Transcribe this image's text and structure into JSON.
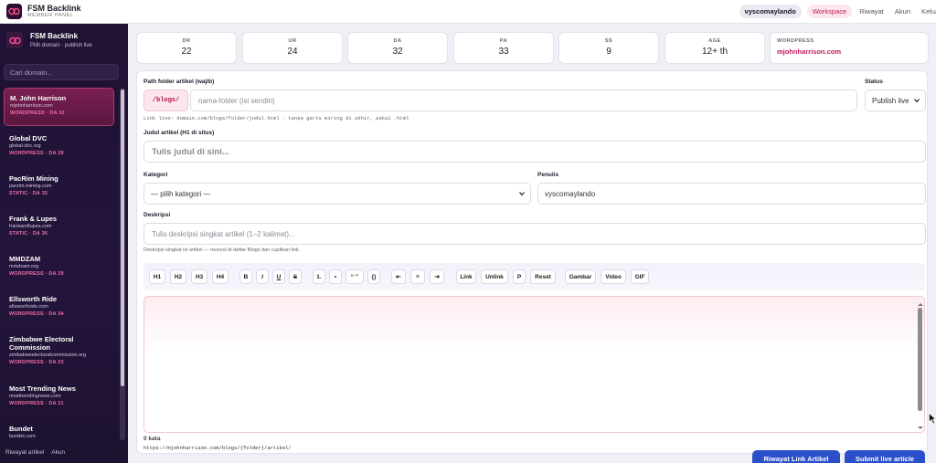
{
  "app": {
    "title": "FSM Backlink",
    "subtitle": "MEMBER PANEL"
  },
  "topnav": {
    "user": "vyscomaylando",
    "links": [
      "Workspace",
      "Riwayat",
      "Akun",
      "Keluar"
    ],
    "active": "Workspace"
  },
  "sidebar": {
    "title": "FSM Backlink",
    "subtitle": "Pilih domain · publish live",
    "search_placeholder": "Cari domain...",
    "domains": [
      {
        "name": "M. John Harrison",
        "url": "mjohnharrison.com",
        "meta": "WORDPRESS · DA 32",
        "active": true
      },
      {
        "name": "Global DVC",
        "url": "global-dvc.org",
        "meta": "WORDPRESS · DA 28"
      },
      {
        "name": "PacRim Mining",
        "url": "pacrim-mining.com",
        "meta": "STATIC · DA 35"
      },
      {
        "name": "Frank & Lupes",
        "url": "frankandlupes.com",
        "meta": "STATIC · DA 36"
      },
      {
        "name": "MMDZAM",
        "url": "mmdzam.org",
        "meta": "WORDPRESS · DA 29"
      },
      {
        "name": "Ellsworth Ride",
        "url": "ellsworthride.com",
        "meta": "WORDPRESS · DA 34"
      },
      {
        "name": "Zimbabwe Electoral Commission",
        "url": "zimbabweelectoralcommission.org",
        "meta": "WORDPRESS · DA 23"
      },
      {
        "name": "Most Trending News",
        "url": "mosttrendingnews.com",
        "meta": "WORDPRESS · DA 21"
      },
      {
        "name": "Bundet",
        "url": "bundet.com",
        "meta": ""
      }
    ],
    "footer": [
      "Riwayat artikel",
      "Akun"
    ]
  },
  "stats": [
    {
      "label": "DR",
      "value": "22"
    },
    {
      "label": "UR",
      "value": "24"
    },
    {
      "label": "DA",
      "value": "32"
    },
    {
      "label": "PA",
      "value": "33"
    },
    {
      "label": "SS",
      "value": "9"
    },
    {
      "label": "AGE",
      "value": "12+ th"
    }
  ],
  "platform": {
    "label": "WORDPRESS",
    "value": "mjohnharrison.com"
  },
  "form": {
    "path_label": "Path folder artikel (wajib)",
    "path_prefix": "/blogs/",
    "path_placeholder": "nama-folder (isi sendiri)",
    "path_hint": "Link live: domain.com/blogs/folder/judul.html · tanpa garis miring di akhir, pakai .html",
    "status_label": "Status",
    "status_value": "Publish live",
    "title_label": "Judul artikel (H1 di situs)",
    "title_placeholder": "Tulis judul di sini...",
    "category_label": "Kategori",
    "category_value": "— pilih kategori —",
    "author_label": "Penulis",
    "author_value": "vyscomaylando",
    "desc_label": "Deskripsi",
    "desc_placeholder": "Tulis deskripsi singkat artikel (1–2 kalimat)...",
    "desc_hint": "Deskripsi singkat isi artikel — muncul di daftar Blogs dan cuplikan link.",
    "word_count": "0 kata",
    "url_preview": "https://mjohnharrison.com/blogs/{folder}/artikel/"
  },
  "toolbar": {
    "buttons": [
      "H1",
      "H2",
      "H3",
      "H4",
      "B",
      "I",
      "U",
      "S",
      "1.",
      "•",
      "“ ”",
      "{}",
      "⇤",
      "≡",
      "⇥",
      "Link",
      "Unlink",
      "P",
      "Reset",
      "Gambar",
      "Video",
      "GIF"
    ]
  },
  "actions": {
    "history": "Riwayat Link Artikel",
    "submit": "Submit live article"
  },
  "colors": {
    "accent": "#c2185b",
    "primary": "#2a4fc9",
    "sidebar_bg": "#1f1233"
  }
}
